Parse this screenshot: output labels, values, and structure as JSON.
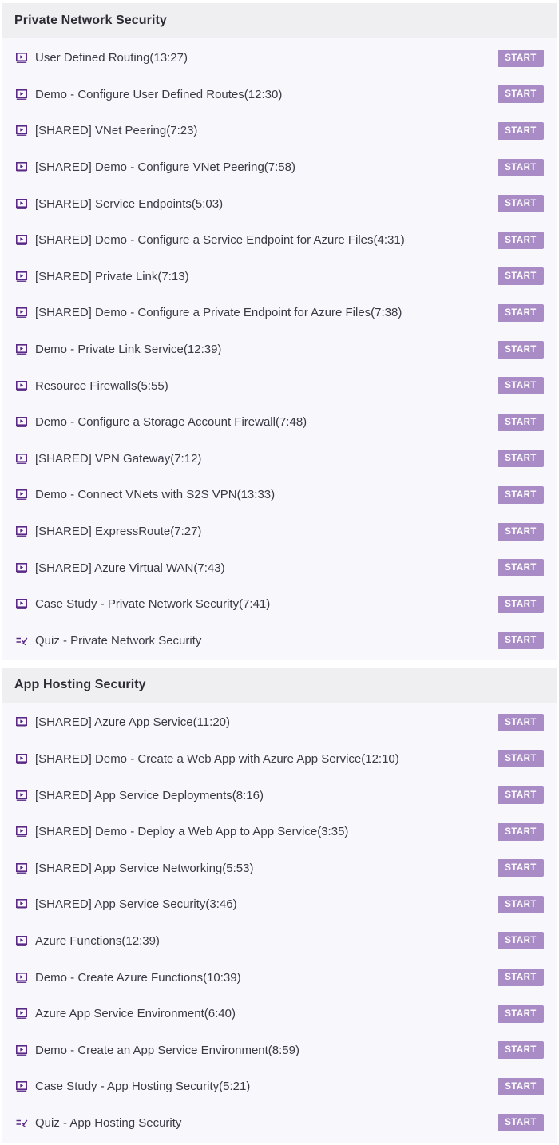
{
  "sections": [
    {
      "title": "Private Network Security",
      "items": [
        {
          "type": "video",
          "label": "User Defined Routing(13:27)",
          "button": "START"
        },
        {
          "type": "video",
          "label": "Demo - Configure User Defined Routes(12:30)",
          "button": "START"
        },
        {
          "type": "video",
          "label": "[SHARED] VNet Peering(7:23)",
          "button": "START"
        },
        {
          "type": "video",
          "label": "[SHARED] Demo - Configure VNet Peering(7:58)",
          "button": "START"
        },
        {
          "type": "video",
          "label": "[SHARED] Service Endpoints(5:03)",
          "button": "START"
        },
        {
          "type": "video",
          "label": "[SHARED] Demo - Configure a Service Endpoint for Azure Files(4:31)",
          "button": "START"
        },
        {
          "type": "video",
          "label": "[SHARED] Private Link(7:13)",
          "button": "START"
        },
        {
          "type": "video",
          "label": "[SHARED] Demo - Configure a Private Endpoint for Azure Files(7:38)",
          "button": "START"
        },
        {
          "type": "video",
          "label": "Demo - Private Link Service(12:39)",
          "button": "START"
        },
        {
          "type": "video",
          "label": "Resource Firewalls(5:55)",
          "button": "START"
        },
        {
          "type": "video",
          "label": "Demo - Configure a Storage Account Firewall(7:48)",
          "button": "START"
        },
        {
          "type": "video",
          "label": "[SHARED] VPN Gateway(7:12)",
          "button": "START"
        },
        {
          "type": "video",
          "label": "Demo - Connect VNets with S2S VPN(13:33)",
          "button": "START"
        },
        {
          "type": "video",
          "label": "[SHARED] ExpressRoute(7:27)",
          "button": "START"
        },
        {
          "type": "video",
          "label": "[SHARED] Azure Virtual WAN(7:43)",
          "button": "START"
        },
        {
          "type": "video",
          "label": "Case Study - Private Network Security(7:41)",
          "button": "START"
        },
        {
          "type": "quiz",
          "label": "Quiz - Private Network Security",
          "button": "START"
        }
      ]
    },
    {
      "title": "App Hosting Security",
      "items": [
        {
          "type": "video",
          "label": "[SHARED] Azure App Service(11:20)",
          "button": "START"
        },
        {
          "type": "video",
          "label": "[SHARED] Demo - Create a Web App with Azure App Service(12:10)",
          "button": "START"
        },
        {
          "type": "video",
          "label": "[SHARED] App Service Deployments(8:16)",
          "button": "START"
        },
        {
          "type": "video",
          "label": "[SHARED] Demo - Deploy a Web App to App Service(3:35)",
          "button": "START"
        },
        {
          "type": "video",
          "label": "[SHARED] App Service Networking(5:53)",
          "button": "START"
        },
        {
          "type": "video",
          "label": "[SHARED] App Service Security(3:46)",
          "button": "START"
        },
        {
          "type": "video",
          "label": "Azure Functions(12:39)",
          "button": "START"
        },
        {
          "type": "video",
          "label": "Demo - Create Azure Functions(10:39)",
          "button": "START"
        },
        {
          "type": "video",
          "label": "Azure App Service Environment(6:40)",
          "button": "START"
        },
        {
          "type": "video",
          "label": "Demo - Create an App Service Environment(8:59)",
          "button": "START"
        },
        {
          "type": "video",
          "label": "Case Study - App Hosting Security(5:21)",
          "button": "START"
        },
        {
          "type": "quiz",
          "label": "Quiz - App Hosting Security",
          "button": "START"
        }
      ]
    }
  ],
  "icons": {
    "video": "play-video-icon",
    "quiz": "quiz-icon"
  },
  "colors": {
    "accent": "#a98cc6",
    "icon": "#5b2a86",
    "header_bg": "#efeff2",
    "row_bg": "#f8f8fc"
  }
}
